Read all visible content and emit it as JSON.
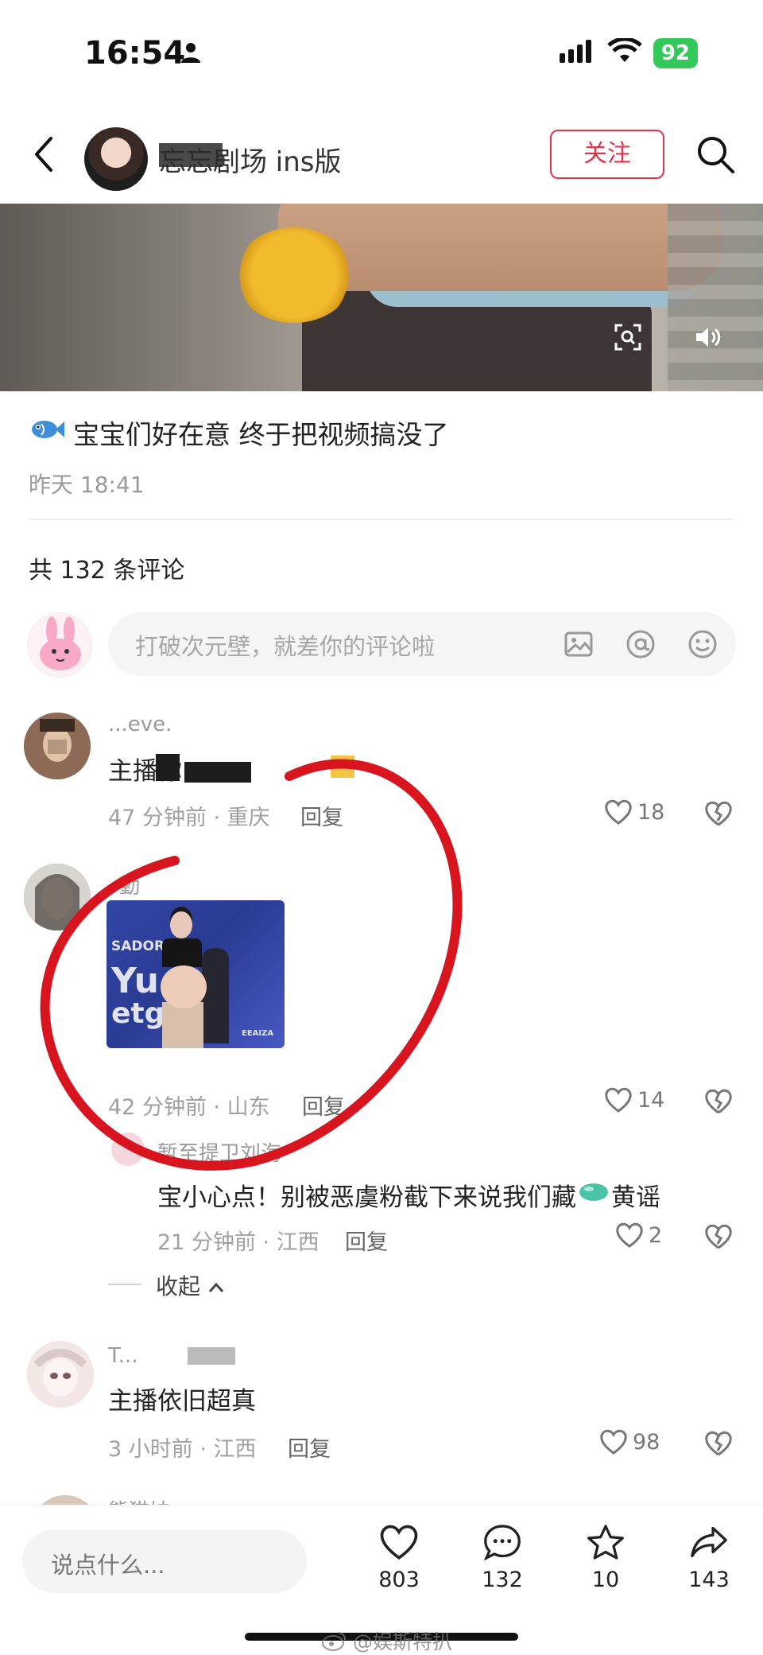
{
  "status_bar": {
    "time": "16:54",
    "battery": "92"
  },
  "header": {
    "author_name": "忘忘剧场 ins版",
    "follow_label": "关注"
  },
  "post": {
    "caption": "宝宝们好在意 终于把视频搞没了",
    "time": "昨天 18:41"
  },
  "comments_section": {
    "count_label": "共 132 条评论",
    "input_placeholder": "打破次元壁，就差你的评论啦"
  },
  "comments": [
    {
      "name": "...eve.",
      "text": "主播你 ...",
      "time_loc": "47 分钟前 · 重庆",
      "reply": "回复",
      "likes": "18"
    },
    {
      "name": "勤",
      "time_loc": "42 分钟前 · 山东",
      "reply": "回复",
      "likes": "14",
      "image_text": {
        "a": "SADOR",
        "b": "Yu",
        "c": "etg",
        "d": "EEAIZA"
      }
    },
    {
      "name": "暂至提卫刘海",
      "text": "宝小心点！别被恶虞粉截下来说我们藏",
      "text_tail": "黄谣",
      "time_loc": "21 分钟前 · 江西",
      "reply": "回复",
      "likes": "2"
    },
    {
      "name": "T...",
      "text": "主播依旧超真",
      "time_loc": "3 小时前 · 江西",
      "reply": "回复",
      "likes": "98"
    },
    {
      "name": "熊猫妹"
    }
  ],
  "collapse_label": "收起",
  "bottom_bar": {
    "say_placeholder": "说点什么...",
    "likes": "803",
    "comments": "132",
    "stars": "10",
    "shares": "143"
  },
  "watermark": "@娱斯特扒",
  "colors": {
    "accent": "#e0344b",
    "battery": "#34c759",
    "annotation": "#d8151f"
  }
}
